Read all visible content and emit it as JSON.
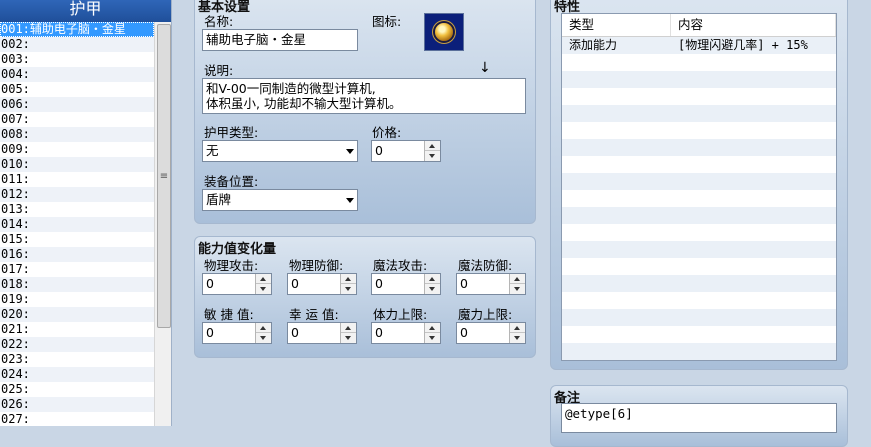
{
  "list": {
    "header": "护甲",
    "items": [
      "001:辅助电子脑・金星",
      "002:",
      "003:",
      "004:",
      "005:",
      "006:",
      "007:",
      "008:",
      "009:",
      "010:",
      "011:",
      "012:",
      "013:",
      "014:",
      "015:",
      "016:",
      "017:",
      "018:",
      "019:",
      "020:",
      "021:",
      "022:",
      "023:",
      "024:",
      "025:",
      "026:",
      "027:"
    ]
  },
  "basic": {
    "title": "基本设置",
    "name_label": "名称:",
    "name_value": "辅助电子脑・金星",
    "icon_label": "图标:",
    "desc_label": "说明:",
    "desc_value": "和V-00一同制造的微型计算机,\n体积虽小, 功能却不输大型计算机。",
    "armor_type_label": "护甲类型:",
    "armor_type_value": "无",
    "price_label": "价格:",
    "price_value": "0",
    "equip_slot_label": "装备位置:",
    "equip_slot_value": "盾牌"
  },
  "params": {
    "title": "能力值变化量",
    "fields": [
      {
        "label": "物理攻击:",
        "value": "0"
      },
      {
        "label": "物理防御:",
        "value": "0"
      },
      {
        "label": "魔法攻击:",
        "value": "0"
      },
      {
        "label": "魔法防御:",
        "value": "0"
      },
      {
        "label": "敏 捷 值:",
        "value": "0"
      },
      {
        "label": "幸 运 值:",
        "value": "0"
      },
      {
        "label": "体力上限:",
        "value": "0"
      },
      {
        "label": "魔力上限:",
        "value": "0"
      }
    ]
  },
  "traits": {
    "title": "特性",
    "col_type": "类型",
    "col_content": "内容",
    "rows": [
      {
        "type": "添加能力",
        "content": "[物理闪避几率] + 15%"
      }
    ]
  },
  "note": {
    "title": "备注",
    "value": "@etype[6]"
  },
  "cursor_glyph": "↓"
}
